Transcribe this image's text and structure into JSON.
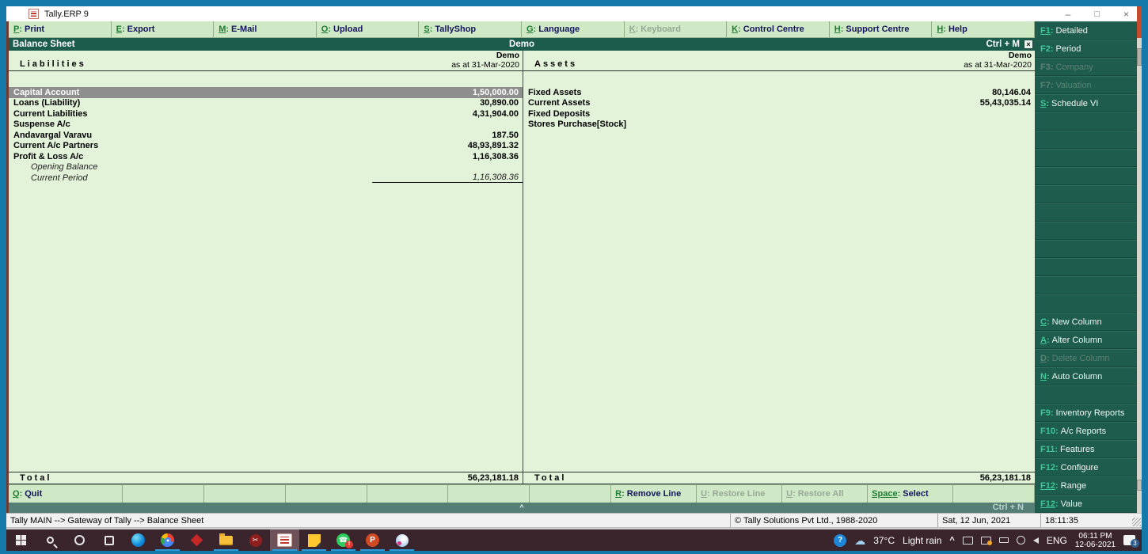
{
  "window": {
    "title": "Tally.ERP 9",
    "controls": {
      "minimize": "–",
      "maximize": "□",
      "close": "×"
    }
  },
  "menu": {
    "items": [
      {
        "key": "P",
        "label": "Print",
        "enabled": true
      },
      {
        "key": "E",
        "label": "Export",
        "enabled": true
      },
      {
        "key": "M",
        "label": "E-Mail",
        "enabled": true
      },
      {
        "key": "O",
        "label": "Upload",
        "enabled": true
      },
      {
        "key": "S",
        "label": "TallyShop",
        "enabled": true
      },
      {
        "key": "G",
        "label": "Language",
        "enabled": true
      },
      {
        "key": "K",
        "label": "Keyboard",
        "enabled": false
      },
      {
        "key": "K",
        "label": "Control Centre",
        "enabled": true
      },
      {
        "key": "H",
        "label": "Support Centre",
        "enabled": true
      },
      {
        "key": "H",
        "label": "Help",
        "enabled": true
      }
    ]
  },
  "report": {
    "title": "Balance Sheet",
    "company": "Demo",
    "shortcut": "Ctrl + M",
    "close_glyph": "×",
    "left": {
      "header": "Liabilities",
      "col_company": "Demo",
      "col_period": "as at 31-Mar-2020",
      "rows": [
        {
          "name": "Capital Account",
          "value": "1,50,000.00",
          "selected": true
        },
        {
          "name": "Loans (Liability)",
          "value": "30,890.00"
        },
        {
          "name": "Current Liabilities",
          "value": "4,31,904.00"
        },
        {
          "name": "Suspense A/c",
          "value": ""
        },
        {
          "name": "Andavargal Varavu",
          "value": "187.50"
        },
        {
          "name": "Current A/c Partners",
          "value": "48,93,891.32"
        },
        {
          "name": "Profit & Loss A/c",
          "value": "1,16,308.36"
        },
        {
          "name": "Opening Balance",
          "value": "",
          "italic": true
        },
        {
          "name": "Current Period",
          "value": "1,16,308.36",
          "italic": true,
          "underline": true
        }
      ],
      "total_label": "Total",
      "total_value": "56,23,181.18"
    },
    "right": {
      "header": "Assets",
      "col_company": "Demo",
      "col_period": "as at 31-Mar-2020",
      "rows": [
        {
          "name": "Fixed Assets",
          "value": "80,146.04"
        },
        {
          "name": "Current Assets",
          "value": "55,43,035.14"
        },
        {
          "name": "Fixed Deposits",
          "value": ""
        },
        {
          "name": "Stores Purchase[Stock]",
          "value": ""
        }
      ],
      "total_label": "Total",
      "total_value": "56,23,181.18"
    }
  },
  "bottom_bar": {
    "buttons": [
      {
        "key": "Q",
        "label": "Quit",
        "enabled": true
      },
      {},
      {},
      {},
      {},
      {},
      {},
      {
        "key": "R",
        "label": "Remove Line",
        "enabled": true
      },
      {
        "key": "U",
        "label": "Restore Line",
        "enabled": false
      },
      {
        "key": "U",
        "label": "Restore All",
        "enabled": false
      },
      {
        "key": "Space",
        "label": "Select",
        "enabled": true
      },
      {}
    ]
  },
  "collapse_bar": {
    "arrow": "^",
    "shortcut": "Ctrl + N"
  },
  "status_bar": {
    "path": "Tally MAIN --> Gateway of Tally --> Balance Sheet",
    "copyright": "© Tally Solutions Pvt Ltd., 1988-2020",
    "date": "Sat, 12 Jun, 2021",
    "time": "18:11:35"
  },
  "sidebar": {
    "buttons": [
      {
        "key": "F1",
        "label": "Detailed",
        "enabled": true,
        "underline": true
      },
      {
        "key": "F2",
        "label": "Period",
        "enabled": true
      },
      {
        "key": "F3",
        "label": "Company",
        "enabled": false
      },
      {
        "key": "F7",
        "label": "Valuation",
        "enabled": false
      },
      {
        "key": "S",
        "label": "Schedule VI",
        "enabled": true,
        "underline": true
      },
      {},
      {},
      {},
      {},
      {},
      {},
      {},
      {},
      {},
      {},
      {},
      {
        "key": "C",
        "label": "New Column",
        "enabled": true,
        "underline": true
      },
      {
        "key": "A",
        "label": "Alter Column",
        "enabled": true,
        "underline": true
      },
      {
        "key": "D",
        "label": "Delete Column",
        "enabled": false,
        "underline": true
      },
      {
        "key": "N",
        "label": "Auto Column",
        "enabled": true,
        "underline": true
      },
      {},
      {
        "key": "F9",
        "label": "Inventory Reports",
        "enabled": true
      },
      {
        "key": "F10",
        "label": "A/c Reports",
        "enabled": true
      },
      {
        "key": "F11",
        "label": "Features",
        "enabled": true
      },
      {
        "key": "F12",
        "label": "Configure",
        "enabled": true
      },
      {
        "key": "F12",
        "label": "Range",
        "enabled": true,
        "underline": true
      },
      {
        "key": "F12",
        "label": "Value",
        "enabled": true,
        "underline": true
      }
    ]
  },
  "taskbar": {
    "apps": [
      {
        "name": "start"
      },
      {
        "name": "search"
      },
      {
        "name": "cortana"
      },
      {
        "name": "task-view"
      },
      {
        "name": "edge"
      },
      {
        "name": "chrome",
        "open": true
      },
      {
        "name": "anydesk"
      },
      {
        "name": "file-explorer",
        "open": true
      },
      {
        "name": "media-player"
      },
      {
        "name": "tally",
        "open": true,
        "active": true
      },
      {
        "name": "sticky-notes",
        "open": true
      },
      {
        "name": "whatsapp",
        "open": true
      },
      {
        "name": "powerpoint",
        "open": true
      },
      {
        "name": "paint-3d",
        "open": true
      }
    ],
    "help_glyph": "?",
    "weather": {
      "temp": "37°C",
      "condition": "Light rain"
    },
    "hidden_icons_caret": "^",
    "language": "ENG",
    "clock": {
      "time": "06:11 PM",
      "date": "12-06-2021"
    },
    "notification_count": "3"
  }
}
